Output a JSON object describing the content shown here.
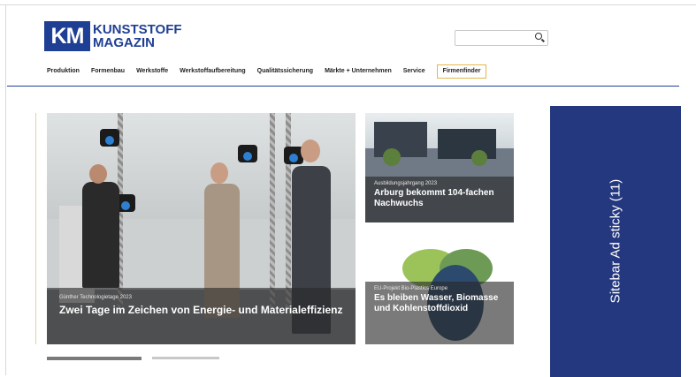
{
  "logo": {
    "mark": "KM",
    "line1": "KUNSTSTOFF",
    "line2": "MAGAZIN"
  },
  "search": {
    "value": "",
    "placeholder": ""
  },
  "nav": {
    "items": [
      {
        "label": "Produktion"
      },
      {
        "label": "Formenbau"
      },
      {
        "label": "Werkstoffe"
      },
      {
        "label": "Werkstoffaufbereitung"
      },
      {
        "label": "Qualitätssicherung"
      },
      {
        "label": "Märkte + Unternehmen"
      },
      {
        "label": "Service"
      },
      {
        "label": "Firmenfinder"
      }
    ]
  },
  "hero": {
    "kicker": "Günther Technologietage 2023",
    "title": "Zwei Tage im Zeichen von Energie- und Materialeffizienz"
  },
  "cards": [
    {
      "kicker": "Ausbildungsjahrgang 2023",
      "title": "Arburg bekommt 104-fachen Nachwuchs"
    },
    {
      "kicker": "EU-Projekt Bio-Plastics Europe",
      "title": "Es bleiben Wasser, Biomasse und Kohlenstoffdioxid"
    }
  ],
  "ad": {
    "label": "Sitebar Ad sticky (11)"
  },
  "colors": {
    "brand": "#1f3f94",
    "ad": "#24387f",
    "highlight": "#e2b74f"
  }
}
